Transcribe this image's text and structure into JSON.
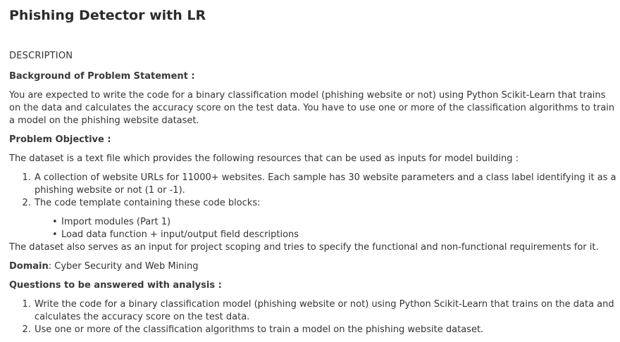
{
  "title": "Phishing Detector with LR",
  "description_heading": "DESCRIPTION",
  "background": {
    "heading": "Background of Problem Statement :",
    "text": "You are expected to write the code for a binary classification model (phishing website or not) using Python Scikit-Learn that trains on the data and calculates the accuracy score on the test data. You have to use one or more of the classification algorithms to train a model on the phishing website dataset."
  },
  "objective": {
    "heading": "Problem Objective :",
    "intro": "The dataset is a text file which provides the following resources that can be used as inputs for model building :",
    "items": [
      " A collection of website URLs for 11000+ websites. Each sample has 30 website parameters and a class label identifying it as a phishing website or not (1 or -1).",
      "The code template containing these code blocks:"
    ],
    "sub_items": [
      "Import modules (Part 1)",
      "Load data function + input/output field descriptions"
    ],
    "closing": "The dataset also serves as an input for project scoping and tries to specify the functional and non-functional requirements for it."
  },
  "domain": {
    "label": "Domain",
    "value": ": Cyber Security and Web Mining"
  },
  "questions": {
    "heading": "Questions to be answered with analysis :",
    "items": [
      "Write the code for a binary classification model (phishing website or not) using Python Scikit-Learn that trains on the data and calculates the accuracy score on the test data.",
      "Use one or more of the classification algorithms to train a model on the phishing website dataset."
    ]
  }
}
